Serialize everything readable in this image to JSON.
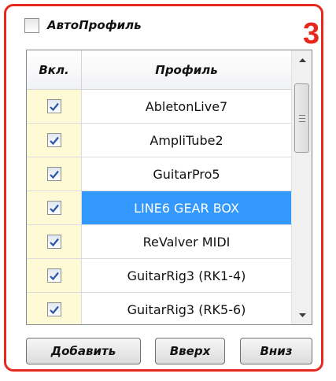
{
  "auto_profile": {
    "label": "АвтоПрофиль",
    "checked": false
  },
  "badge": "3",
  "table": {
    "headers": {
      "enabled": "Вкл.",
      "profile": "Профиль"
    },
    "rows": [
      {
        "name": "AbletonLive7",
        "checked": true,
        "selected": false
      },
      {
        "name": "AmpliTube2",
        "checked": true,
        "selected": false
      },
      {
        "name": "GuitarPro5",
        "checked": true,
        "selected": false
      },
      {
        "name": "LINE6 GEAR BOX",
        "checked": true,
        "selected": true
      },
      {
        "name": "ReValver MIDI",
        "checked": true,
        "selected": false
      },
      {
        "name": "GuitarRig3 (RK1-4)",
        "checked": true,
        "selected": false
      },
      {
        "name": "GuitarRig3 (RK5-6)",
        "checked": true,
        "selected": false
      }
    ]
  },
  "buttons": {
    "add": "Добавить",
    "up": "Вверх",
    "down": "Вниз"
  },
  "colors": {
    "frame": "#e8271d",
    "selection": "#3399ff",
    "enabled_column": "#fefad6",
    "check_mark": "#2a56a8"
  }
}
